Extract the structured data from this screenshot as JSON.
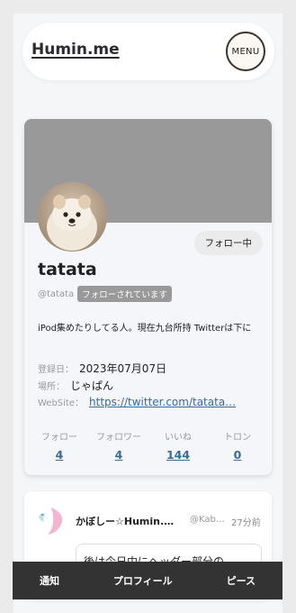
{
  "header": {
    "brand": "Humin.me",
    "menu_label": "MENU"
  },
  "profile": {
    "follow_button": "フォロー中",
    "name": "tatata",
    "handle": "@tatata",
    "followed_badge": "フォローされています",
    "bio": "iPod集めたりしてる人。現在九台所持 Twitterは下に",
    "registered_label": "登録日：",
    "registered_value": "2023年07月07日",
    "location_label": "場所：",
    "location_value": "じゃぱん",
    "website_label": "WebSite：",
    "website_value": "https://twitter.com/tatata…",
    "stats": [
      {
        "label": "フォロー",
        "value": "4"
      },
      {
        "label": "フォロワー",
        "value": "4"
      },
      {
        "label": "いいね",
        "value": "144"
      },
      {
        "label": "トロン",
        "value": "0"
      }
    ]
  },
  "post": {
    "author": "かぼしー☆Humin.…",
    "handle": "@Kab…",
    "time": "27分前",
    "body": "後は今日中にヘッダー部分の…"
  },
  "nav": {
    "items": [
      "通知",
      "プロフィール",
      "ピース"
    ]
  },
  "colors": {
    "link": "#3a6a9a",
    "banner": "#999999",
    "nav_bg": "#333333"
  }
}
